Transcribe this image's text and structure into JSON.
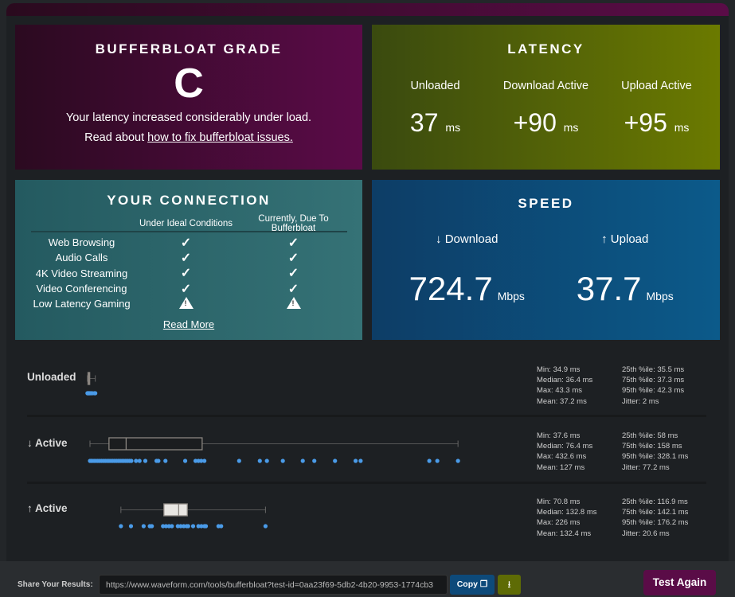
{
  "grade": {
    "title": "BUFFERBLOAT GRADE",
    "letter": "C",
    "message": "Your latency increased considerably under load.",
    "read_prefix": "Read about ",
    "link": "how to fix bufferbloat issues."
  },
  "latency": {
    "title": "LATENCY",
    "unit": "ms",
    "cols": [
      {
        "label": "Unloaded",
        "value": "37"
      },
      {
        "label": "Download Active",
        "value": "+90"
      },
      {
        "label": "Upload Active",
        "value": "+95"
      }
    ]
  },
  "connection": {
    "title": "YOUR CONNECTION",
    "col1": "Under Ideal Conditions",
    "col2": "Currently, Due To Bufferbloat",
    "read_more": "Read More",
    "rows": [
      {
        "name": "Web Browsing",
        "ideal": "check",
        "current": "check"
      },
      {
        "name": "Audio Calls",
        "ideal": "check",
        "current": "check"
      },
      {
        "name": "4K Video Streaming",
        "ideal": "check",
        "current": "check"
      },
      {
        "name": "Video Conferencing",
        "ideal": "check",
        "current": "check"
      },
      {
        "name": "Low Latency Gaming",
        "ideal": "warning",
        "current": "warning"
      }
    ]
  },
  "speed": {
    "title": "SPEED",
    "unit": "Mbps",
    "download_label": "↓ Download",
    "download": "724.7",
    "upload_label": "↑ Upload",
    "upload": "37.7"
  },
  "chart_data": {
    "type": "boxplot",
    "unit": "ms",
    "point_color": "#4a9be8",
    "rows": [
      {
        "label": "Unloaded",
        "stats": [
          "Min: 34.9 ms",
          "25th %ile: 35.5 ms",
          "Median: 36.4 ms",
          "75th %ile: 37.3 ms",
          "Max: 43.3 ms",
          "95th %ile: 42.3 ms",
          "Mean: 37.2 ms",
          "Jitter: 2 ms"
        ],
        "min": 34.9,
        "q1": 35.5,
        "median": 36.4,
        "q3": 37.3,
        "max": 43.3,
        "box_fill": "#1b1d1f",
        "points": [
          34.9,
          35.2,
          35.5,
          36,
          36.4,
          36.8,
          37.3,
          38,
          39,
          40,
          42.3,
          43.3
        ]
      },
      {
        "label": "↓ Active",
        "stats": [
          "Min: 37.6 ms",
          "25th %ile: 58 ms",
          "Median: 76.4 ms",
          "75th %ile: 158 ms",
          "Max: 432.6 ms",
          "95th %ile: 328.1 ms",
          "Mean: 127 ms",
          "Jitter: 77.2 ms"
        ],
        "min": 37.6,
        "q1": 58,
        "median": 76.4,
        "q3": 158,
        "max": 432.6,
        "box_fill": "#1b1d1f",
        "points": [
          37.6,
          39,
          40,
          42,
          44,
          46,
          48,
          50,
          52,
          54,
          56,
          58,
          60,
          62,
          64,
          66,
          68,
          70,
          72,
          74,
          76,
          78,
          80,
          82,
          87,
          90.8,
          97,
          109,
          111,
          118.6,
          139.8,
          150.9,
          154,
          157,
          160.4,
          197.7,
          219.9,
          227.5,
          244.6,
          266,
          278.4,
          300.6,
          322.7,
          328.1,
          401.8,
          410.4,
          432.6
        ]
      },
      {
        "label": "↑ Active",
        "stats": [
          "Min: 70.8 ms",
          "25th %ile: 116.9 ms",
          "Median: 132.8 ms",
          "75th %ile: 142.1 ms",
          "Max: 226 ms",
          "95th %ile: 176.2 ms",
          "Mean: 132.4 ms",
          "Jitter: 20.6 ms"
        ],
        "min": 70.8,
        "q1": 116.9,
        "median": 132.8,
        "q3": 142.1,
        "max": 226,
        "box_fill": "#e8e6e2",
        "points": [
          70.8,
          81.6,
          95.2,
          101.8,
          104,
          116,
          119.2,
          122.4,
          125.5,
          131.9,
          135,
          138.2,
          141.4,
          143,
          148.3,
          154,
          157.2,
          160.4,
          162,
          175.5,
          178.4,
          226
        ]
      }
    ]
  },
  "footer": {
    "share_label": "Share Your Results:",
    "share_url": "https://www.waveform.com/tools/bufferbloat?test-id=0aa23f69-5db2-4b20-9953-1774cb3",
    "copy": "Copy",
    "test_again": "Test Again"
  }
}
